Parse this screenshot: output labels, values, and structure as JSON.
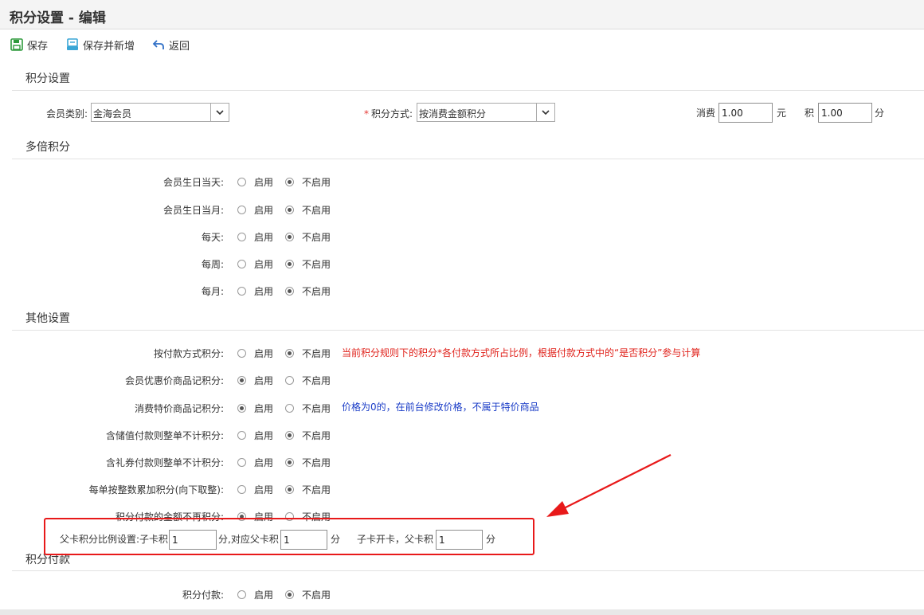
{
  "page_title": "积分设置 - 编辑",
  "toolbar": {
    "save": "保存",
    "save_new": "保存并新增",
    "back": "返回"
  },
  "sections": {
    "points_settings": "积分设置",
    "multiplier": "多倍积分",
    "other": "其他设置",
    "points_payment": "积分付款"
  },
  "basic": {
    "member_type_label": "会员类别:",
    "member_type_value": "金海会员",
    "points_method_label": "积分方式:",
    "points_method_value": "按消费金额积分",
    "consume_label": "消费",
    "consume_value": "1.00",
    "yuan_unit": "元",
    "points_label": "积",
    "points_value": "1.00",
    "fen_unit": "分"
  },
  "radio_labels": {
    "enable": "启用",
    "disable": "不启用"
  },
  "multiplier_rows": [
    {
      "label": "会员生日当天:",
      "enabled": false
    },
    {
      "label": "会员生日当月:",
      "enabled": false
    },
    {
      "label": "每天:",
      "enabled": false
    },
    {
      "label": "每周:",
      "enabled": false
    },
    {
      "label": "每月:",
      "enabled": false
    }
  ],
  "other_rows": [
    {
      "label": "按付款方式积分:",
      "enabled": false
    },
    {
      "label": "会员优惠价商品记积分:",
      "enabled": true
    },
    {
      "label": "消费特价商品记积分:",
      "enabled": true
    },
    {
      "label": "含储值付款则整单不计积分:",
      "enabled": false
    },
    {
      "label": "含礼券付款则整单不计积分:",
      "enabled": false
    },
    {
      "label": "每单按整数累加积分(向下取整):",
      "enabled": false
    },
    {
      "label": "积分付款的金额不再积分:",
      "enabled": true
    }
  ],
  "notes": {
    "payment_method": "当前积分规则下的积分*各付款方式所占比例，根据付款方式中的“是否积分”参与计算",
    "special_price": "价格为0的，在前台修改价格，不属于特价商品"
  },
  "parent_card": {
    "label": "父卡积分比例设置:子卡积",
    "child_value": "1",
    "mid_label": "分,对应父卡积",
    "parent_value": "1",
    "fen1": "分",
    "open_label": "子卡开卡，父卡积",
    "open_value": "1",
    "fen2": "分"
  },
  "payment_rows": [
    {
      "label": "积分付款:",
      "enabled": false
    }
  ],
  "colors": {
    "highlight": "#e8191a",
    "note_red": "#e0231c",
    "note_blue": "#1a3cc7"
  }
}
